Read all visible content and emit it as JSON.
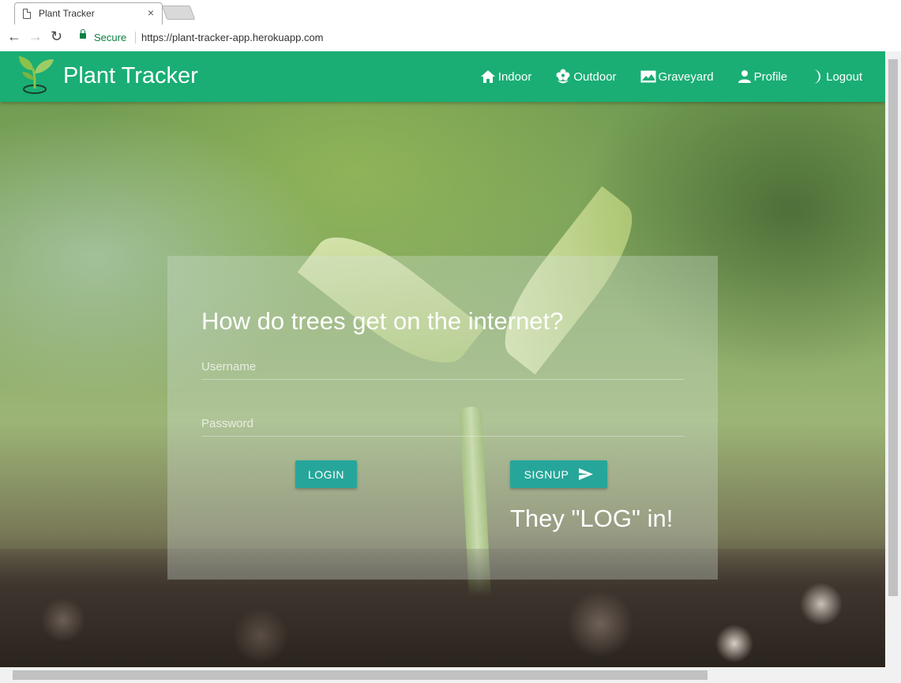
{
  "browser": {
    "tab_title": "Plant Tracker",
    "tab_close": "×",
    "secure_label": "Secure",
    "url": "https://plant-tracker-app.herokuapp.com",
    "back": "←",
    "forward": "→",
    "reload": "↻"
  },
  "navbar": {
    "brand": "Plant Tracker",
    "items": [
      {
        "label": "Indoor",
        "icon": "home-icon"
      },
      {
        "label": "Outdoor",
        "icon": "flower-icon"
      },
      {
        "label": "Graveyard",
        "icon": "landscape-icon"
      },
      {
        "label": "Profile",
        "icon": "person-icon"
      },
      {
        "label": "Logout",
        "icon": "moon-icon"
      }
    ]
  },
  "login_card": {
    "heading": "How do trees get on the internet?",
    "username_placeholder": "Username",
    "password_placeholder": "Password",
    "login_label": "LOGIN",
    "signup_label": "SIGNUP",
    "punchline": "They \"LOG\" in!"
  },
  "colors": {
    "navbar": "#1aae74",
    "button": "#26a69a",
    "secure": "#0b8043"
  }
}
